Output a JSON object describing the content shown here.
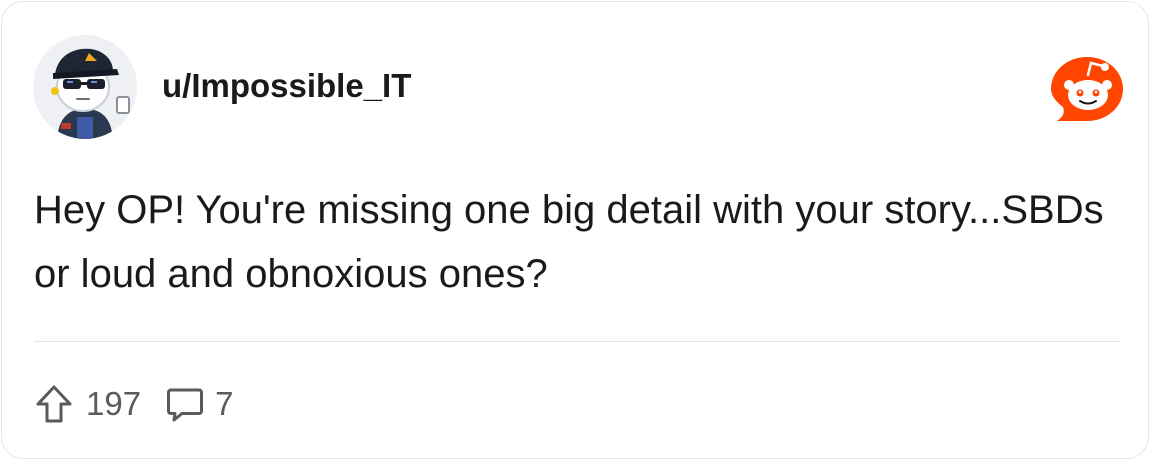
{
  "post": {
    "username": "u/Impossible_IT",
    "body": "Hey OP! You're missing one big detail with your story...SBDs or loud and obnoxious ones?",
    "upvotes": "197",
    "comments": "7"
  },
  "colors": {
    "reddit_orange": "#ff4500",
    "text": "#1a1a1b",
    "muted": "#5a5a5a"
  },
  "icons": {
    "avatar": "snoo-avatar-with-cap-and-sunglasses",
    "logo": "reddit-snoo-icon",
    "upvote": "upvote-arrow-icon",
    "comment": "comment-bubble-icon"
  }
}
